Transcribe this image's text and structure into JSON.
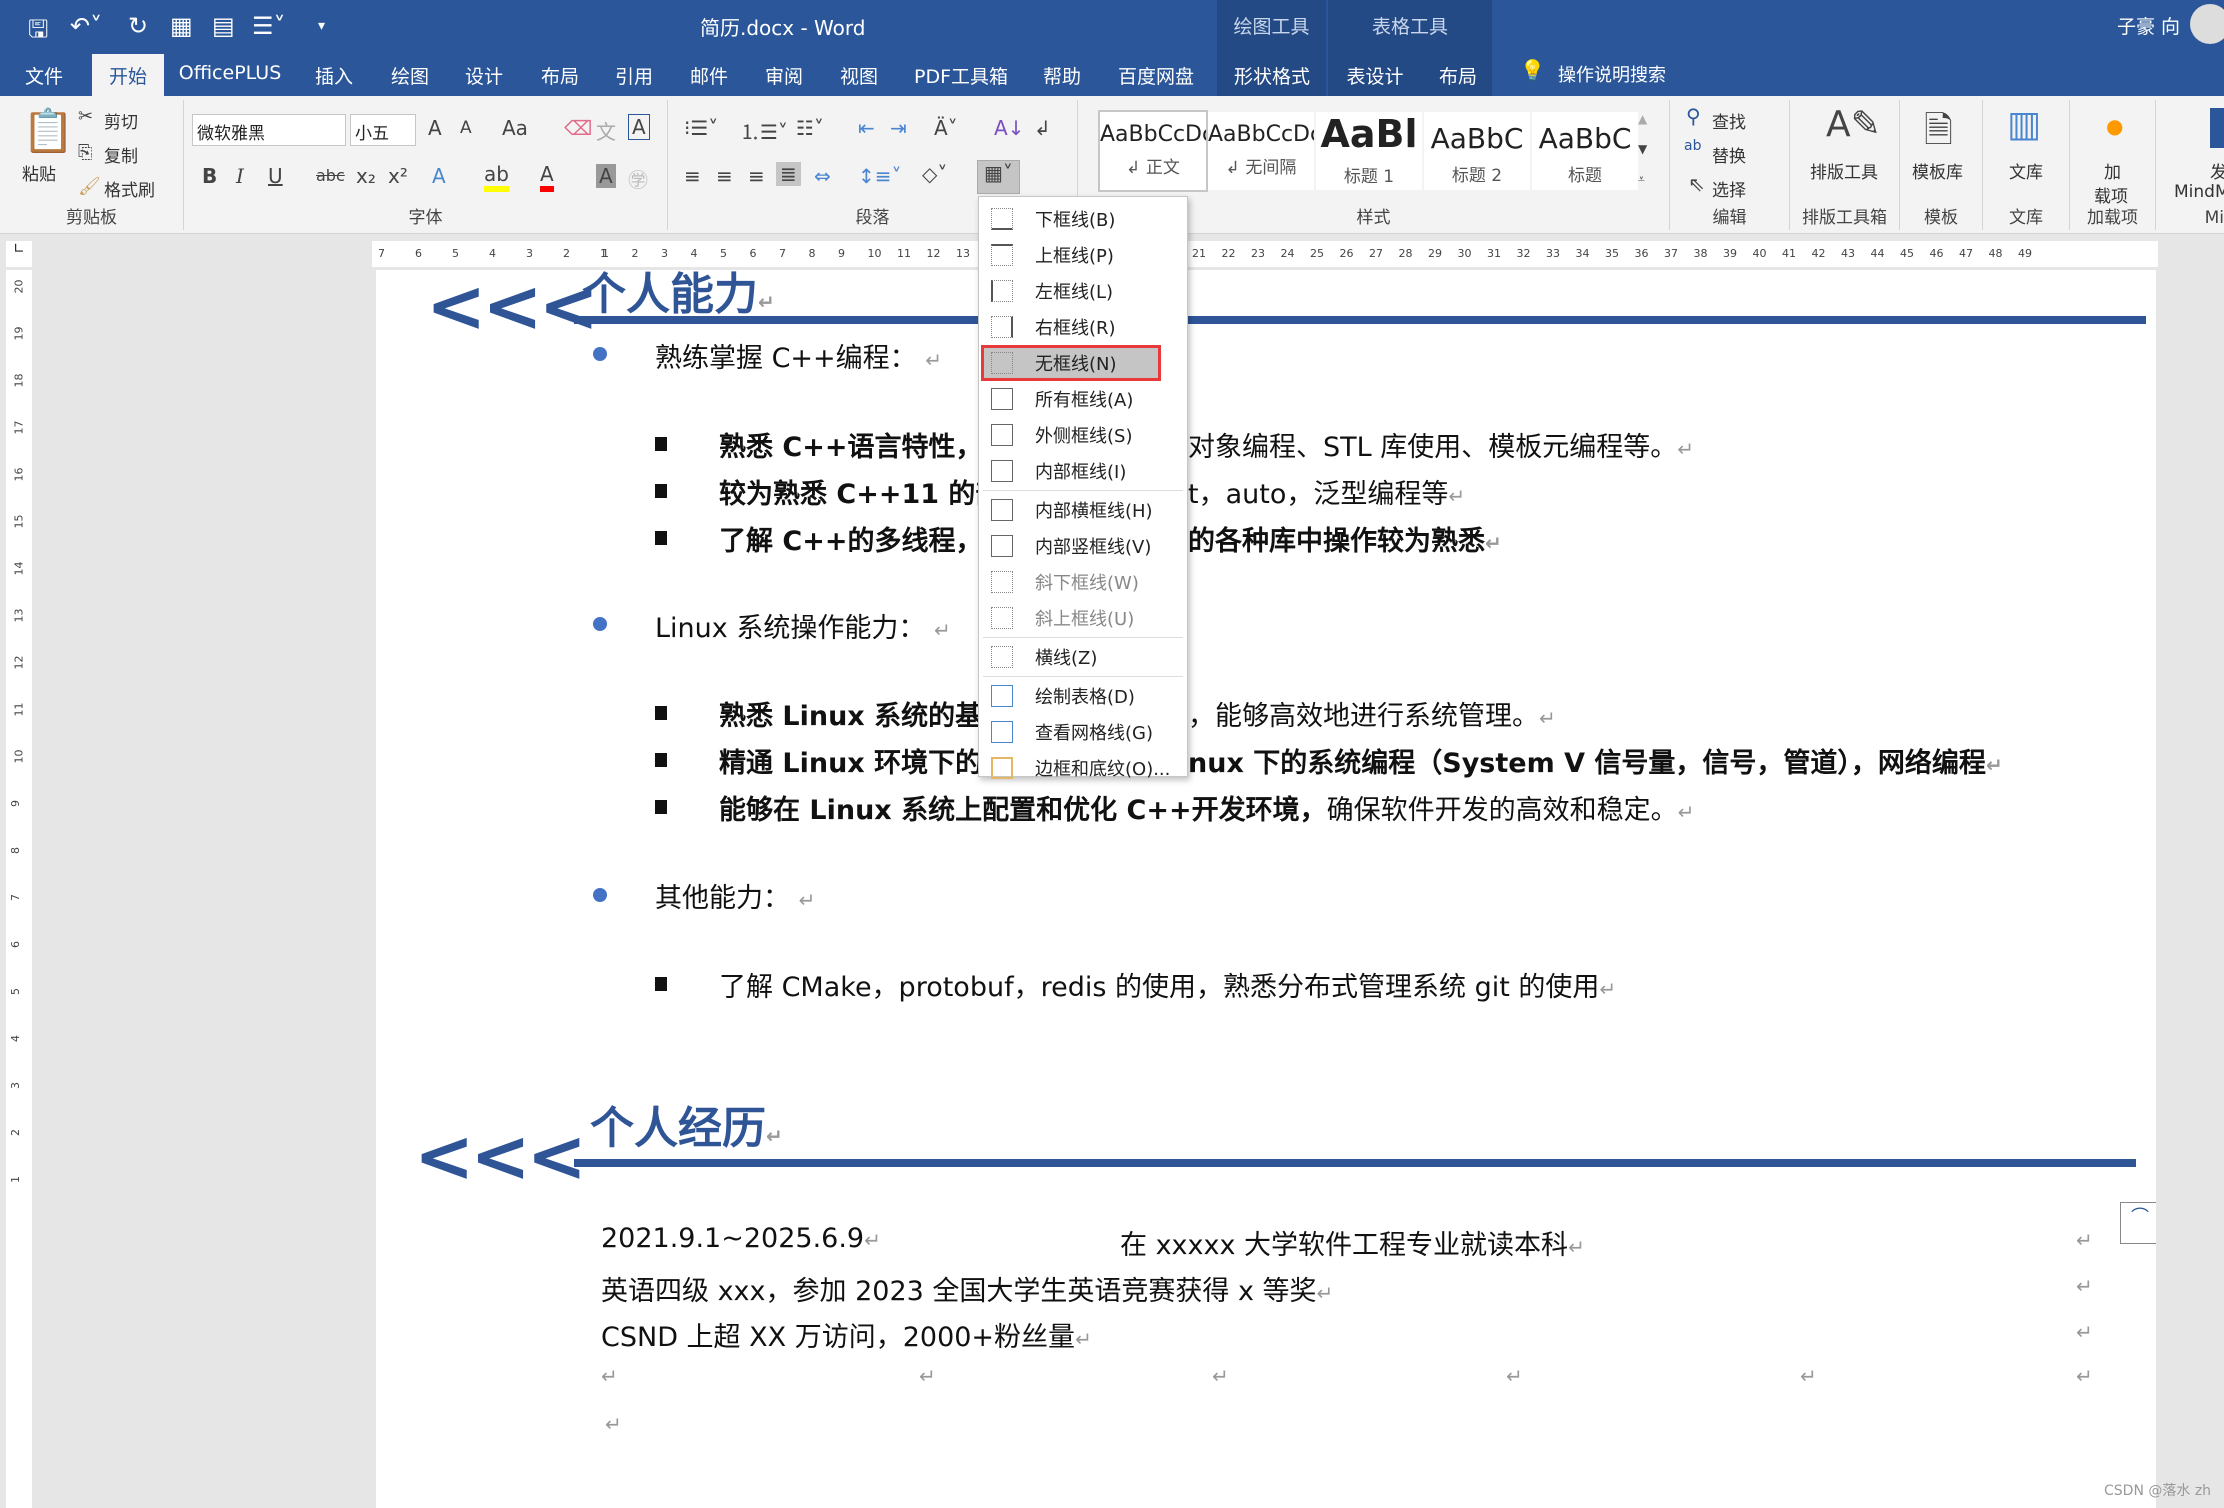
{
  "titlebar": {
    "title": "简历.docx  -  Word",
    "context_drawing": "绘图工具",
    "context_table": "表格工具",
    "user": "子豪 向",
    "qat": [
      "save-icon",
      "undo-icon",
      "redo-icon",
      "table-icon",
      "edit-table-icon",
      "numbering-icon",
      "customize-icon"
    ]
  },
  "tabs": [
    "文件",
    "开始",
    "OfficePLUS",
    "插入",
    "绘图",
    "设计",
    "布局",
    "引用",
    "邮件",
    "审阅",
    "视图",
    "PDF工具箱",
    "帮助",
    "百度网盘",
    "形状格式",
    "表设计",
    "布局"
  ],
  "tell_me": "操作说明搜索",
  "ribbon": {
    "clipboard": {
      "label": "剪贴板",
      "paste": "粘贴",
      "cut": "剪切",
      "copy": "复制",
      "format_painter": "格式刷"
    },
    "font": {
      "label": "字体",
      "font_name": "微软雅黑",
      "font_size": "小五",
      "bold": "B",
      "italic": "I",
      "underline": "U",
      "strike": "abc",
      "sub": "x₂",
      "sup": "x²",
      "grow": "A",
      "shrink": "A",
      "case": "Aa",
      "phonetic": "文",
      "border_char": "A",
      "highlight_color": "#ffff00",
      "font_color": "#ff0000"
    },
    "paragraph": {
      "label": "段落"
    },
    "styles": {
      "label": "样式",
      "items": [
        {
          "preview": "AaBbCcDc",
          "name": "↲ 正文"
        },
        {
          "preview": "AaBbCcDc",
          "name": "↲ 无间隔"
        },
        {
          "preview": "AaBl",
          "name": "标题 1"
        },
        {
          "preview": "AaBbC",
          "name": "标题 2"
        },
        {
          "preview": "AaBbC",
          "name": "标题"
        }
      ]
    },
    "editing": {
      "label": "编辑",
      "find": "查找",
      "replace": "替换",
      "select": "选择"
    },
    "layout_tools": {
      "label": "排版工具箱",
      "button": "排版工具"
    },
    "templates": {
      "label": "模板",
      "button": "模板库"
    },
    "library": {
      "label": "文库",
      "button": "文库"
    },
    "addins": {
      "label": "加载项",
      "button1": "加",
      "button2": "载项"
    },
    "mindmap": {
      "label": "Mi",
      "button1": "发",
      "button2": "MindM"
    }
  },
  "ruler": {
    "left": [
      7,
      6,
      5,
      4,
      3,
      2,
      1
    ],
    "right_max": 49,
    "vertical_max": 20
  },
  "menu": {
    "items": [
      {
        "label": "下框线(B)",
        "icon": "bottom-border-icon"
      },
      {
        "label": "上框线(P)",
        "icon": "top-border-icon"
      },
      {
        "label": "左框线(L)",
        "icon": "left-border-icon"
      },
      {
        "label": "右框线(R)",
        "icon": "right-border-icon"
      },
      {
        "label": "无框线(N)",
        "icon": "no-border-icon",
        "selected": true
      },
      {
        "label": "所有框线(A)",
        "icon": "all-borders-icon"
      },
      {
        "label": "外侧框线(S)",
        "icon": "outside-borders-icon"
      },
      {
        "label": "内部框线(I)",
        "icon": "inside-borders-icon",
        "sep_after": true
      },
      {
        "label": "内部横框线(H)",
        "icon": "inside-horizontal-border-icon"
      },
      {
        "label": "内部竖框线(V)",
        "icon": "inside-vertical-border-icon"
      },
      {
        "label": "斜下框线(W)",
        "icon": "diagonal-down-border-icon",
        "disabled": true
      },
      {
        "label": "斜上框线(U)",
        "icon": "diagonal-up-border-icon",
        "disabled": true,
        "sep_after": true
      },
      {
        "label": "横线(Z)",
        "icon": "horizontal-line-icon",
        "sep_after": true
      },
      {
        "label": "绘制表格(D)",
        "icon": "draw-table-icon"
      },
      {
        "label": "查看网格线(G)",
        "icon": "view-gridlines-icon"
      },
      {
        "label": "边框和底纹(O)...",
        "icon": "borders-shading-icon"
      }
    ]
  },
  "doc": {
    "section1": {
      "heading": "个人能力",
      "chevron": "<<<",
      "groups": [
        {
          "title": "熟练掌握 C++编程：",
          "items": [
            "熟悉 C++语言特性，",
            "对象编程、STL 库使用、模板元编程等。",
            "较为熟悉 C++11 的部",
            "t，auto，泛型编程等",
            "了解 C++的多线程，",
            "的各种库中操作较为熟悉"
          ]
        },
        {
          "title": "Linux 系统操作能力：",
          "items": [
            "熟悉 Linux 系统的基",
            "，能够高效地进行系统管理。",
            "精通 Linux 环境下的",
            "nux 下的系统编程（System V 信号量，信号，管道），网络编程",
            "能够在 Linux 系统上配置和优化 C++开发环境，",
            "确保软件开发的高效和稳定。"
          ]
        },
        {
          "title": "其他能力：",
          "items": [
            "了解 CMake，protobuf，redis 的使用，熟悉分布式管理系统 git 的使用"
          ]
        }
      ]
    },
    "section2": {
      "heading": "个人经历",
      "chevron": "<<<",
      "rows": [
        {
          "left": "2021.9.1~2025.6.9",
          "right": "在 xxxxx 大学软件工程专业就读本科"
        },
        {
          "left": "英语四级 xxx，参加 2023 全国大学生英语竞赛获得 x 等奖"
        },
        {
          "left": "CSND 上超 XX 万访问，2000+粉丝量"
        }
      ]
    },
    "paragraph_mark": "↵"
  },
  "watermark": "CSDN @落水 zh",
  "colors": {
    "accent": "#2b579a",
    "heading": "#2f5597",
    "bullet": "#4472c4",
    "highlight_border": "#e83a3a"
  }
}
